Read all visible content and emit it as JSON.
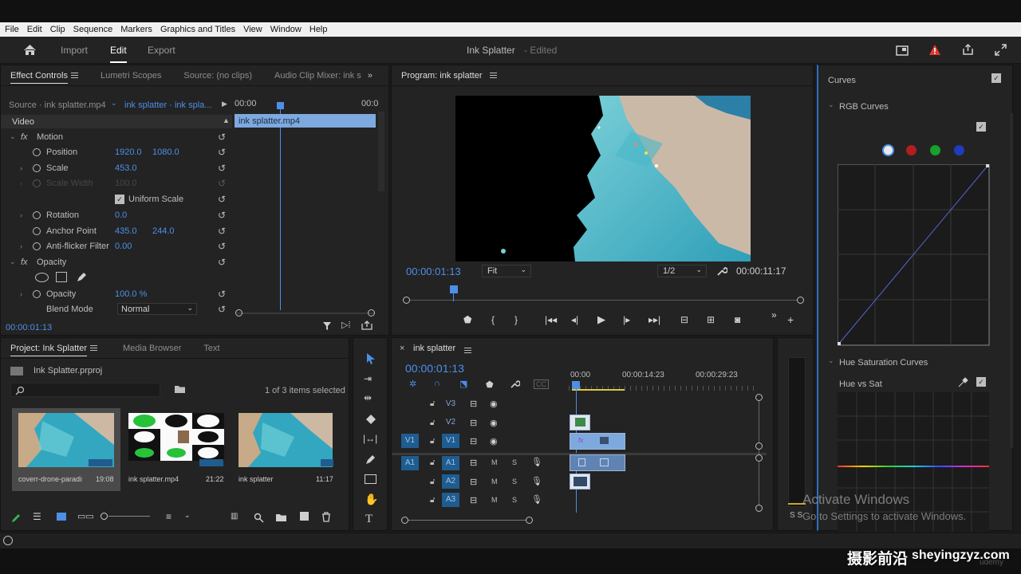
{
  "menu": [
    "File",
    "Edit",
    "Clip",
    "Sequence",
    "Markers",
    "Graphics and Titles",
    "View",
    "Window",
    "Help"
  ],
  "workspace": {
    "tabs": [
      "Import",
      "Edit",
      "Export"
    ],
    "active": "Edit",
    "project_title": "Ink Splatter",
    "edited_suffix": "- Edited"
  },
  "effect_controls": {
    "tabs": [
      "Effect Controls",
      "Lumetri Scopes",
      "Source: (no clips)",
      "Audio Clip Mixer: ink s"
    ],
    "source_label": "Source · ink splatter.mp4",
    "sequence_label": "ink splatter · ink spla...",
    "ruler_start": "00:00",
    "ruler_end": "00:0",
    "clip_name": "ink splatter.mp4",
    "section_video": "Video",
    "motion": "Motion",
    "position": {
      "label": "Position",
      "x": "1920.0",
      "y": "1080.0"
    },
    "scale": {
      "label": "Scale",
      "value": "453.0"
    },
    "scale_width": {
      "label": "Scale Width",
      "value": "100.0"
    },
    "uniform_scale": "Uniform Scale",
    "rotation": {
      "label": "Rotation",
      "value": "0.0"
    },
    "anchor_point": {
      "label": "Anchor Point",
      "x": "435.0",
      "y": "244.0"
    },
    "anti_flicker": {
      "label": "Anti-flicker Filter",
      "value": "0.00"
    },
    "opacity_section": "Opacity",
    "opacity": {
      "label": "Opacity",
      "value": "100.0 %"
    },
    "blend_mode": {
      "label": "Blend Mode",
      "value": "Normal"
    },
    "timecode": "00:00:01:13"
  },
  "program": {
    "title": "Program: ink splatter",
    "timecode": "00:00:01:13",
    "fit": "Fit",
    "resolution": "1/2",
    "duration": "00:00:11:17"
  },
  "lumetri": {
    "curves": "Curves",
    "rgb_curves": "RGB Curves",
    "hue_sat_curves": "Hue Saturation Curves",
    "hue_vs_sat": "Hue vs Sat",
    "channel_colors": [
      "#e8e8e8",
      "#b01e1e",
      "#17a02a",
      "#1e3cc0"
    ]
  },
  "project": {
    "tabs": [
      "Project: Ink Splatter",
      "Media Browser",
      "Text"
    ],
    "file": "Ink Splatter.prproj",
    "selection": "1 of 3 items selected",
    "items": [
      {
        "name": "coverr-drone-paradisia...",
        "duration": "19:08"
      },
      {
        "name": "ink splatter.mp4",
        "duration": "21:22"
      },
      {
        "name": "ink splatter",
        "duration": "11:17"
      }
    ]
  },
  "timeline": {
    "title": "ink splatter",
    "timecode": "00:00:01:13",
    "ruler": [
      "00:00",
      "00:00:14:23",
      "00:00:29:23"
    ],
    "video_tracks": [
      "V3",
      "V2",
      "V1"
    ],
    "audio_tracks": [
      "A1",
      "A2",
      "A3"
    ],
    "source_v": "V1",
    "source_a": "A1",
    "mute": "M",
    "solo": "S"
  },
  "audio_meter_label": "S S",
  "activation": {
    "title": "Activate Windows",
    "subtitle": "Go to Settings to activate Windows."
  },
  "watermark": {
    "cn": "摄影前沿",
    "url": "sheyingzyz.com",
    "udemy": "udemy"
  }
}
